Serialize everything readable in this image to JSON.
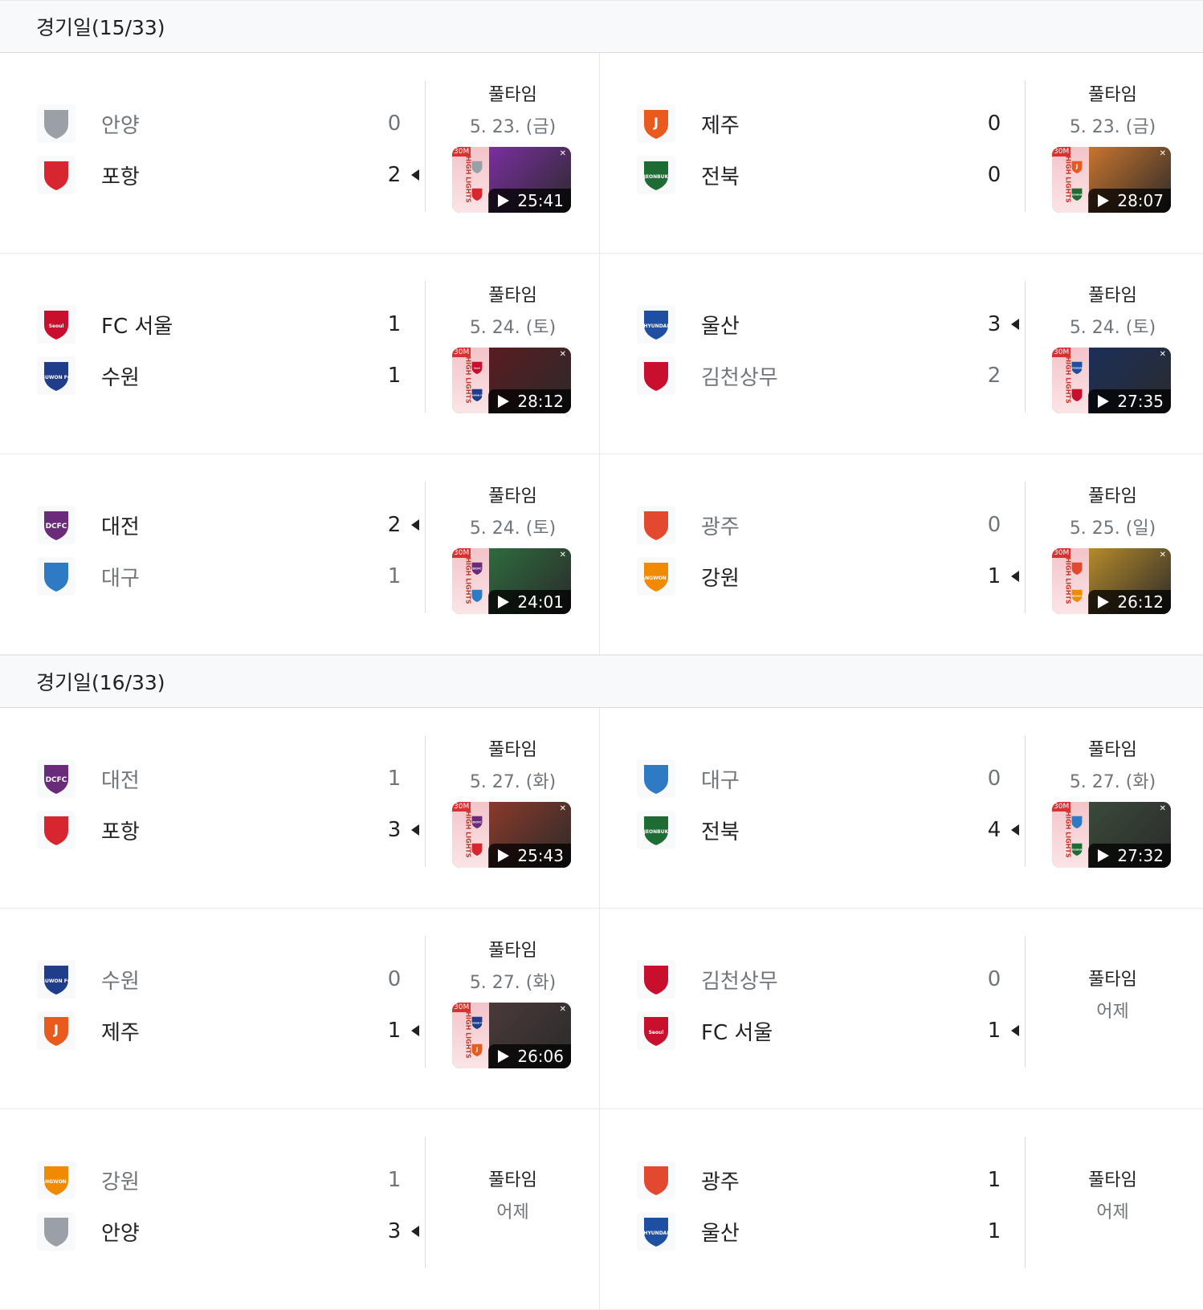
{
  "rounds": [
    {
      "title": "경기일(15/33)",
      "matches": [
        {
          "home": {
            "name": "안양",
            "score": "0",
            "logo": "anyang-logo",
            "winner": false
          },
          "away": {
            "name": "포항",
            "score": "2",
            "logo": "pohang-logo",
            "winner": true
          },
          "status": "풀타임",
          "date": "5. 23. (금)",
          "video": {
            "duration": "25:41",
            "photo": "#7a2fa0"
          }
        },
        {
          "home": {
            "name": "제주",
            "score": "0",
            "logo": "jeju-logo",
            "winner": false
          },
          "away": {
            "name": "전북",
            "score": "0",
            "logo": "jeonbuk-logo",
            "winner": false
          },
          "status": "풀타임",
          "date": "5. 23. (금)",
          "video": {
            "duration": "28:07",
            "photo": "#c8742e"
          }
        },
        {
          "home": {
            "name": "FC 서울",
            "score": "1",
            "logo": "seoul-logo",
            "winner": false
          },
          "away": {
            "name": "수원",
            "score": "1",
            "logo": "suwon-logo",
            "winner": false
          },
          "status": "풀타임",
          "date": "5. 24. (토)",
          "video": {
            "duration": "28:12",
            "photo": "#5a1c22"
          }
        },
        {
          "home": {
            "name": "울산",
            "score": "3",
            "logo": "ulsan-logo",
            "winner": true
          },
          "away": {
            "name": "김천상무",
            "score": "2",
            "logo": "gimcheon-logo",
            "winner": false
          },
          "status": "풀타임",
          "date": "5. 24. (토)",
          "video": {
            "duration": "27:35",
            "photo": "#1c2f5a"
          }
        },
        {
          "home": {
            "name": "대전",
            "score": "2",
            "logo": "daejeon-logo",
            "winner": true
          },
          "away": {
            "name": "대구",
            "score": "1",
            "logo": "daegu-logo",
            "winner": false
          },
          "status": "풀타임",
          "date": "5. 24. (토)",
          "video": {
            "duration": "24:01",
            "photo": "#2e6b3e"
          }
        },
        {
          "home": {
            "name": "광주",
            "score": "0",
            "logo": "gwangju-logo",
            "winner": false
          },
          "away": {
            "name": "강원",
            "score": "1",
            "logo": "gangwon-logo",
            "winner": true
          },
          "status": "풀타임",
          "date": "5. 25. (일)",
          "video": {
            "duration": "26:12",
            "photo": "#b58a2a"
          }
        }
      ]
    },
    {
      "title": "경기일(16/33)",
      "matches": [
        {
          "home": {
            "name": "대전",
            "score": "1",
            "logo": "daejeon-logo",
            "winner": false
          },
          "away": {
            "name": "포항",
            "score": "3",
            "logo": "pohang-logo",
            "winner": true
          },
          "status": "풀타임",
          "date": "5. 27. (화)",
          "video": {
            "duration": "25:43",
            "photo": "#8a3a2a"
          }
        },
        {
          "home": {
            "name": "대구",
            "score": "0",
            "logo": "daegu-logo",
            "winner": false
          },
          "away": {
            "name": "전북",
            "score": "4",
            "logo": "jeonbuk-logo",
            "winner": true
          },
          "status": "풀타임",
          "date": "5. 27. (화)",
          "video": {
            "duration": "27:32",
            "photo": "#3a4a3a"
          }
        },
        {
          "home": {
            "name": "수원",
            "score": "0",
            "logo": "suwon-logo",
            "winner": false
          },
          "away": {
            "name": "제주",
            "score": "1",
            "logo": "jeju-logo",
            "winner": true
          },
          "status": "풀타임",
          "date": "5. 27. (화)",
          "video": {
            "duration": "26:06",
            "photo": "#4a3a3a"
          }
        },
        {
          "home": {
            "name": "김천상무",
            "score": "0",
            "logo": "gimcheon-logo",
            "winner": false
          },
          "away": {
            "name": "FC 서울",
            "score": "1",
            "logo": "seoul-logo",
            "winner": true
          },
          "status": "풀타임",
          "date": "어제",
          "video": null
        },
        {
          "home": {
            "name": "강원",
            "score": "1",
            "logo": "gangwon-logo",
            "winner": false
          },
          "away": {
            "name": "안양",
            "score": "3",
            "logo": "anyang-logo",
            "winner": true
          },
          "status": "풀타임",
          "date": "어제",
          "video": null
        },
        {
          "home": {
            "name": "광주",
            "score": "1",
            "logo": "gwangju-logo",
            "winner": false
          },
          "away": {
            "name": "울산",
            "score": "1",
            "logo": "ulsan-logo",
            "winner": false
          },
          "status": "풀타임",
          "date": "어제",
          "video": null
        }
      ]
    }
  ],
  "video_badge": "30M",
  "video_strip_text": "HIGH LIGHTS",
  "logo_colors": {
    "anyang-logo": "#9aa0a6",
    "pohang-logo": "#d7262f",
    "jeju-logo": "#e85a1e",
    "jeonbuk-logo": "#1f6b34",
    "seoul-logo": "#c8102e",
    "suwon-logo": "#1f3d8a",
    "ulsan-logo": "#1f4fa0",
    "gimcheon-logo": "#c8102e",
    "daejeon-logo": "#6a2c7a",
    "daegu-logo": "#2e7bc4",
    "gwangju-logo": "#e2492e",
    "gangwon-logo": "#f08a00"
  },
  "logo_text": {
    "anyang-logo": "",
    "pohang-logo": "",
    "jeju-logo": "J",
    "jeonbuk-logo": "JEONBUK",
    "seoul-logo": "Seoul",
    "suwon-logo": "SUWON FC",
    "ulsan-logo": "HYUNDAI",
    "gimcheon-logo": "",
    "daejeon-logo": "DCFC",
    "daegu-logo": "",
    "gwangju-logo": "",
    "gangwon-logo": "GANGWON FC"
  }
}
